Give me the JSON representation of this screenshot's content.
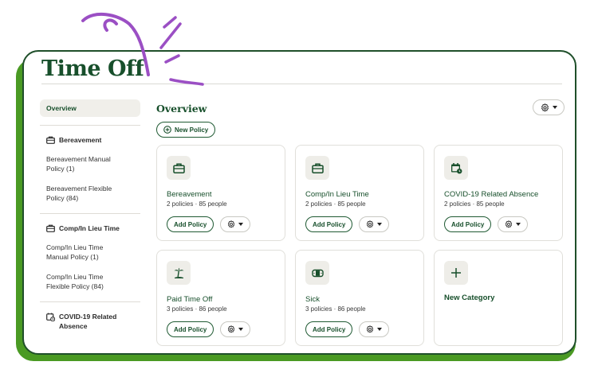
{
  "page": {
    "title": "Time Off"
  },
  "sidebar": {
    "overview_label": "Overview",
    "sections": [
      {
        "heading": "Bereavement",
        "icon": "briefcase-icon",
        "items": [
          "Bereavement Manual Policy (1)",
          "Bereavement Flexible Policy (84)"
        ]
      },
      {
        "heading": "Comp/In Lieu Time",
        "icon": "briefcase-icon",
        "items": [
          "Comp/In Lieu Time Manual Policy (1)",
          "Comp/In Lieu Time Flexible Policy (84)"
        ]
      },
      {
        "heading": "COVID-19 Related Absence",
        "icon": "calendar-clock-icon",
        "items": []
      }
    ]
  },
  "main": {
    "title": "Overview",
    "new_policy_label": "New Policy",
    "add_policy_label": "Add Policy",
    "cards": [
      {
        "title": "Bereavement",
        "subtitle": "2 policies · 85 people",
        "icon": "briefcase-icon"
      },
      {
        "title": "Comp/In Lieu Time",
        "subtitle": "2 policies · 85 people",
        "icon": "briefcase-icon"
      },
      {
        "title": "COVID-19 Related Absence",
        "subtitle": "2 policies · 85 people",
        "icon": "calendar-clock-icon"
      },
      {
        "title": "Paid Time Off",
        "subtitle": "3 policies · 86 people",
        "icon": "palm-tree-icon"
      },
      {
        "title": "Sick",
        "subtitle": "3 policies · 86 people",
        "icon": "bandage-icon"
      }
    ],
    "new_category": {
      "title": "New Category",
      "icon": "plus-icon"
    }
  },
  "colors": {
    "brand_green": "#174f2b",
    "backdrop_green": "#4a9a23",
    "squiggle_purple": "#9b4fc4"
  }
}
